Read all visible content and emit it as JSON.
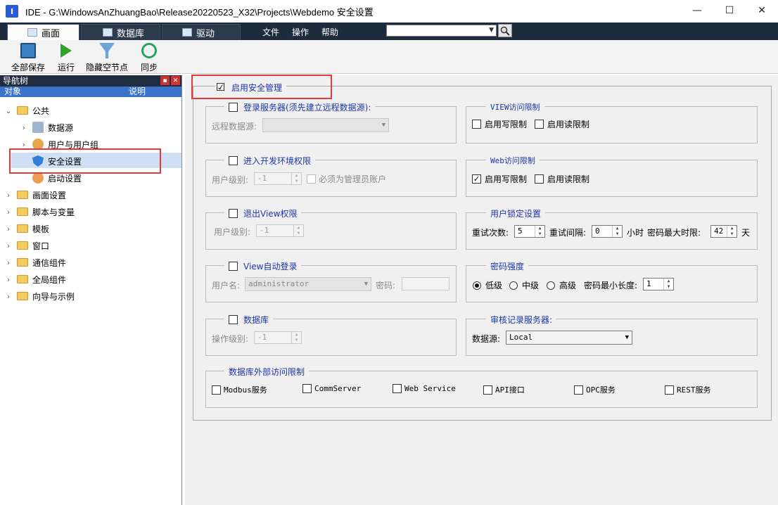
{
  "window": {
    "title": "IDE - G:\\WindowsAnZhuangBao\\Release20220523_X32\\Projects\\Webdemo  安全设置",
    "minimize": "—",
    "maximize": "☐",
    "close": "✕"
  },
  "tabs": [
    "画面",
    "数据库",
    "驱动"
  ],
  "menu": [
    "文件",
    "操作",
    "帮助"
  ],
  "toolbar": [
    "全部保存",
    "运行",
    "隐藏空节点",
    "同步"
  ],
  "nav": {
    "title": "导航树",
    "col_object": "对象",
    "col_desc": "说明",
    "items": [
      "公共",
      "数据源",
      "用户与用户组",
      "安全设置",
      "启动设置",
      "画面设置",
      "脚本与变量",
      "模板",
      "窗口",
      "通信组件",
      "全局组件",
      "向导与示例"
    ]
  },
  "security": {
    "enable_label": "启用安全管理",
    "enable_checked": "☑",
    "login_server": {
      "title": "登录服务器(须先建立远程数据源):",
      "remote_ds_label": "远程数据源:"
    },
    "dev_env": {
      "title": "进入开发环境权限",
      "level_label": "用户级别:",
      "level_value": "-1",
      "admin_label": "必须为管理员账户"
    },
    "exit_view": {
      "title": "退出View权限",
      "level_label": "用户级别:",
      "level_value": "-1"
    },
    "auto_login": {
      "title": "View自动登录",
      "user_label": "用户名:",
      "user_value": "administrator",
      "pwd_label": "密码:"
    },
    "database": {
      "title": "数据库",
      "level_label": "操作级别:",
      "level_value": "-1"
    },
    "view_access": {
      "title": "VIEW访问限制",
      "write": "启用写限制",
      "read": "启用读限制"
    },
    "web_access": {
      "title": "Web访问限制",
      "write": "启用写限制",
      "write_checked": "✓",
      "read": "启用读限制"
    },
    "user_lock": {
      "title": "用户锁定设置",
      "retry_label": "重试次数:",
      "retry_value": "5",
      "interval_label": "重试间隔:",
      "interval_value": "0",
      "hours": "小时",
      "max_label": "密码最大时限:",
      "max_value": "42",
      "days": "天"
    },
    "pwd_strength": {
      "title": "密码强度",
      "low": "低级",
      "mid": "中级",
      "high": "高级",
      "min_len_label": "密码最小长度:",
      "min_len_value": "1"
    },
    "audit": {
      "title": "审核记录服务器:",
      "ds_label": "数据源:",
      "ds_value": "Local"
    },
    "ext_access": {
      "title": "数据库外部访问限制",
      "items": [
        "Modbus服务",
        "CommServer",
        "Web Service",
        "API接口",
        "OPC服务",
        "REST服务"
      ]
    }
  }
}
